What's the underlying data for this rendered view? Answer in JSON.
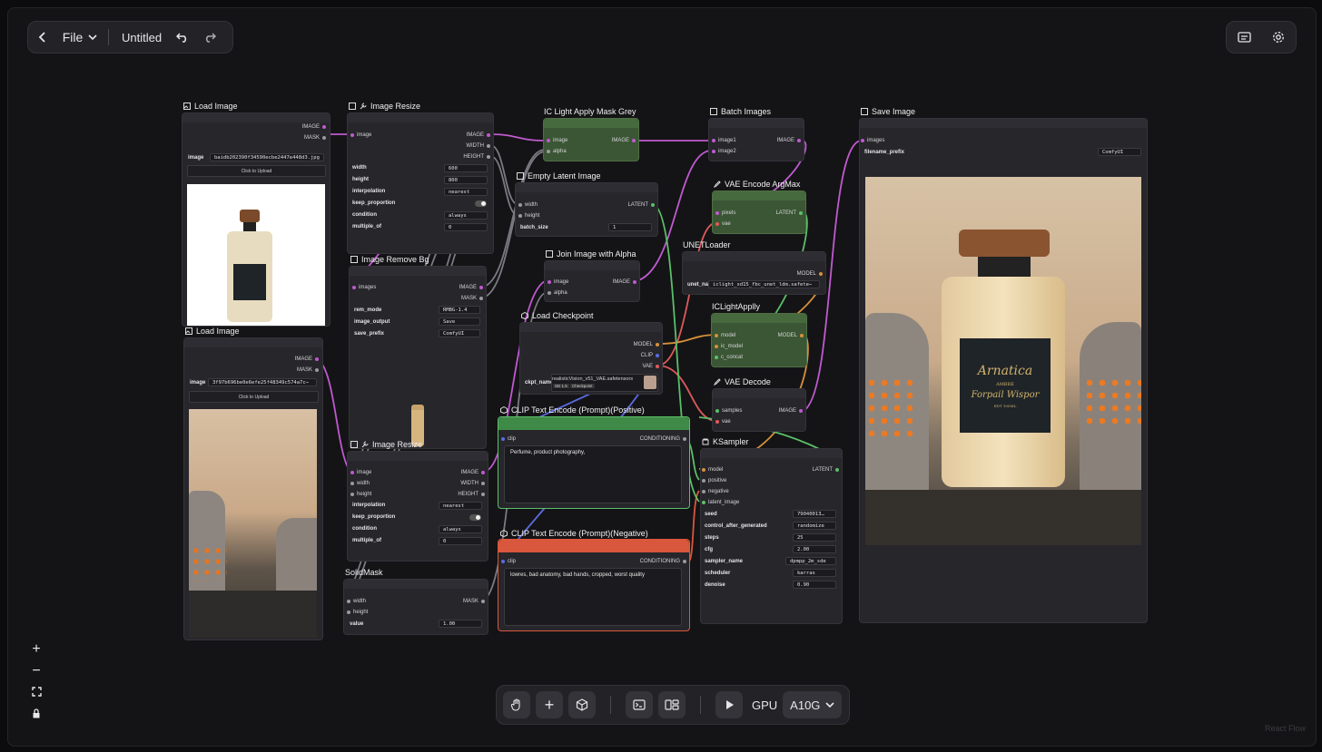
{
  "topbar": {
    "file_label": "File",
    "title": "Untitled"
  },
  "bottombar": {
    "gpu_label": "GPU",
    "gpu_value": "A10G"
  },
  "watermark": "React Flow",
  "nodes": {
    "load_image_1": {
      "title": "Load Image",
      "out_image": "IMAGE",
      "out_mask": "MASK",
      "image_label": "image",
      "image_value": "baidb202390f34590ecbe2447e448d3.jpg",
      "upload": "Click to Upload"
    },
    "load_image_2": {
      "title": "Load Image",
      "out_image": "IMAGE",
      "out_mask": "MASK",
      "image_label": "image",
      "image_value": "3f97b696be0e6efe25f48349c574a7c⋯",
      "upload": "Click to Upload"
    },
    "image_resize_1": {
      "title": "Image Resize",
      "in_image": "image",
      "out_image": "IMAGE",
      "out_width": "WIDTH",
      "out_height": "HEIGHT",
      "fields": [
        {
          "label": "width",
          "value": "600"
        },
        {
          "label": "height",
          "value": "800"
        },
        {
          "label": "interpolation",
          "value": "nearest"
        },
        {
          "label": "keep_proportion",
          "value": ""
        },
        {
          "label": "condition",
          "value": "always"
        },
        {
          "label": "multiple_of",
          "value": "0"
        }
      ]
    },
    "image_remove_bg": {
      "title": "Image Remove Bg",
      "in_images": "images",
      "out_image": "IMAGE",
      "out_mask": "MASK",
      "fields": [
        {
          "label": "rem_mode",
          "value": "RMBG-1.4"
        },
        {
          "label": "image_output",
          "value": "Save"
        },
        {
          "label": "save_prefix",
          "value": "ComfyUI"
        }
      ]
    },
    "image_resize_2": {
      "title": "Image Resize",
      "in_image": "image",
      "in_width": "width",
      "in_height": "height",
      "out_image": "IMAGE",
      "out_width": "WIDTH",
      "out_height": "HEIGHT",
      "fields": [
        {
          "label": "interpolation",
          "value": "nearest"
        },
        {
          "label": "keep_proportion",
          "value": ""
        },
        {
          "label": "condition",
          "value": "always"
        },
        {
          "label": "multiple_of",
          "value": "0"
        }
      ]
    },
    "solid_mask": {
      "title": "SolidMask",
      "in_width": "width",
      "in_height": "height",
      "out_mask": "MASK",
      "value_label": "value",
      "value": "1.00"
    },
    "ic_light_mask": {
      "title": "IC Light Apply Mask Grey",
      "in_image": "image",
      "in_alpha": "alpha",
      "out_image": "IMAGE"
    },
    "empty_latent": {
      "title": "Empty Latent Image",
      "in_width": "width",
      "in_height": "height",
      "out_latent": "LATENT",
      "batch_label": "batch_size",
      "batch_value": "1"
    },
    "join_alpha": {
      "title": "Join Image with Alpha",
      "in_image": "image",
      "in_alpha": "alpha",
      "out_image": "IMAGE"
    },
    "load_checkpoint": {
      "title": "Load Checkpoint",
      "out_model": "MODEL",
      "out_clip": "CLIP",
      "out_vae": "VAE",
      "ckpt_label": "ckpt_name",
      "ckpt_value": "realisticVision_v51_VAE.safetensors",
      "badge1": "SD 1.5",
      "badge2": "Checkpoint"
    },
    "clip_pos": {
      "title": "CLIP Text Encode (Prompt)(Positive)",
      "in_clip": "clip",
      "out": "CONDITIONING",
      "text": "Perfume, product photography,"
    },
    "clip_neg": {
      "title": "CLIP Text Encode (Prompt)(Negative)",
      "in_clip": "clip",
      "out": "CONDITIONING",
      "text": "lowres, bad anatomy, bad hands, cropped, worst quality"
    },
    "batch_images": {
      "title": "Batch Images",
      "in_image1": "image1",
      "in_image2": "image2",
      "out_image": "IMAGE"
    },
    "vae_encode": {
      "title": "VAE Encode ArgMax",
      "in_pixels": "pixels",
      "in_vae": "vae",
      "out_latent": "LATENT"
    },
    "unet_loader": {
      "title": "UNETLoader",
      "out_model": "MODEL",
      "name_label": "unet_na",
      "name_value": "iclight_sd15_fbc_unet_ldm.safete⋯"
    },
    "iclight_apply": {
      "title": "ICLightApplly",
      "in_model": "model",
      "in_ic_model": "ic_model",
      "in_c_concat": "c_concat",
      "out_model": "MODEL"
    },
    "vae_decode": {
      "title": "VAE Decode",
      "in_samples": "samples",
      "in_vae": "vae",
      "out_image": "IMAGE"
    },
    "ksampler": {
      "title": "KSampler",
      "in_model": "model",
      "in_positive": "positive",
      "in_negative": "negative",
      "in_latent": "latent_image",
      "out_latent": "LATENT",
      "fields": [
        {
          "label": "seed",
          "value": "79040013…"
        },
        {
          "label": "control_after_generated",
          "value": "randomize"
        },
        {
          "label": "steps",
          "value": "25"
        },
        {
          "label": "cfg",
          "value": "2.00"
        },
        {
          "label": "sampler_name",
          "value": "dpmpp_2m_sde"
        },
        {
          "label": "scheduler",
          "value": "karras"
        },
        {
          "label": "denoise",
          "value": "0.90"
        }
      ]
    },
    "save_image": {
      "title": "Save Image",
      "in_images": "images",
      "prefix_label": "filename_prefix",
      "prefix_value": "ComfyUI"
    }
  },
  "bottle_label": {
    "brand": "Arnatica",
    "line2": "AMBRE",
    "script": "Forpail Wispor",
    "small": "EDT 100ML"
  },
  "colors": {
    "image_wire": "#c05ad0",
    "latent_wire": "#5bbf6a",
    "model_wire": "#d7903a",
    "clip_wire": "#5b6be0",
    "vae_wire": "#e05a5a",
    "gray_wire": "#7a7a82",
    "positive_node": "#3f8a46",
    "negative_node": "#d9573c"
  }
}
